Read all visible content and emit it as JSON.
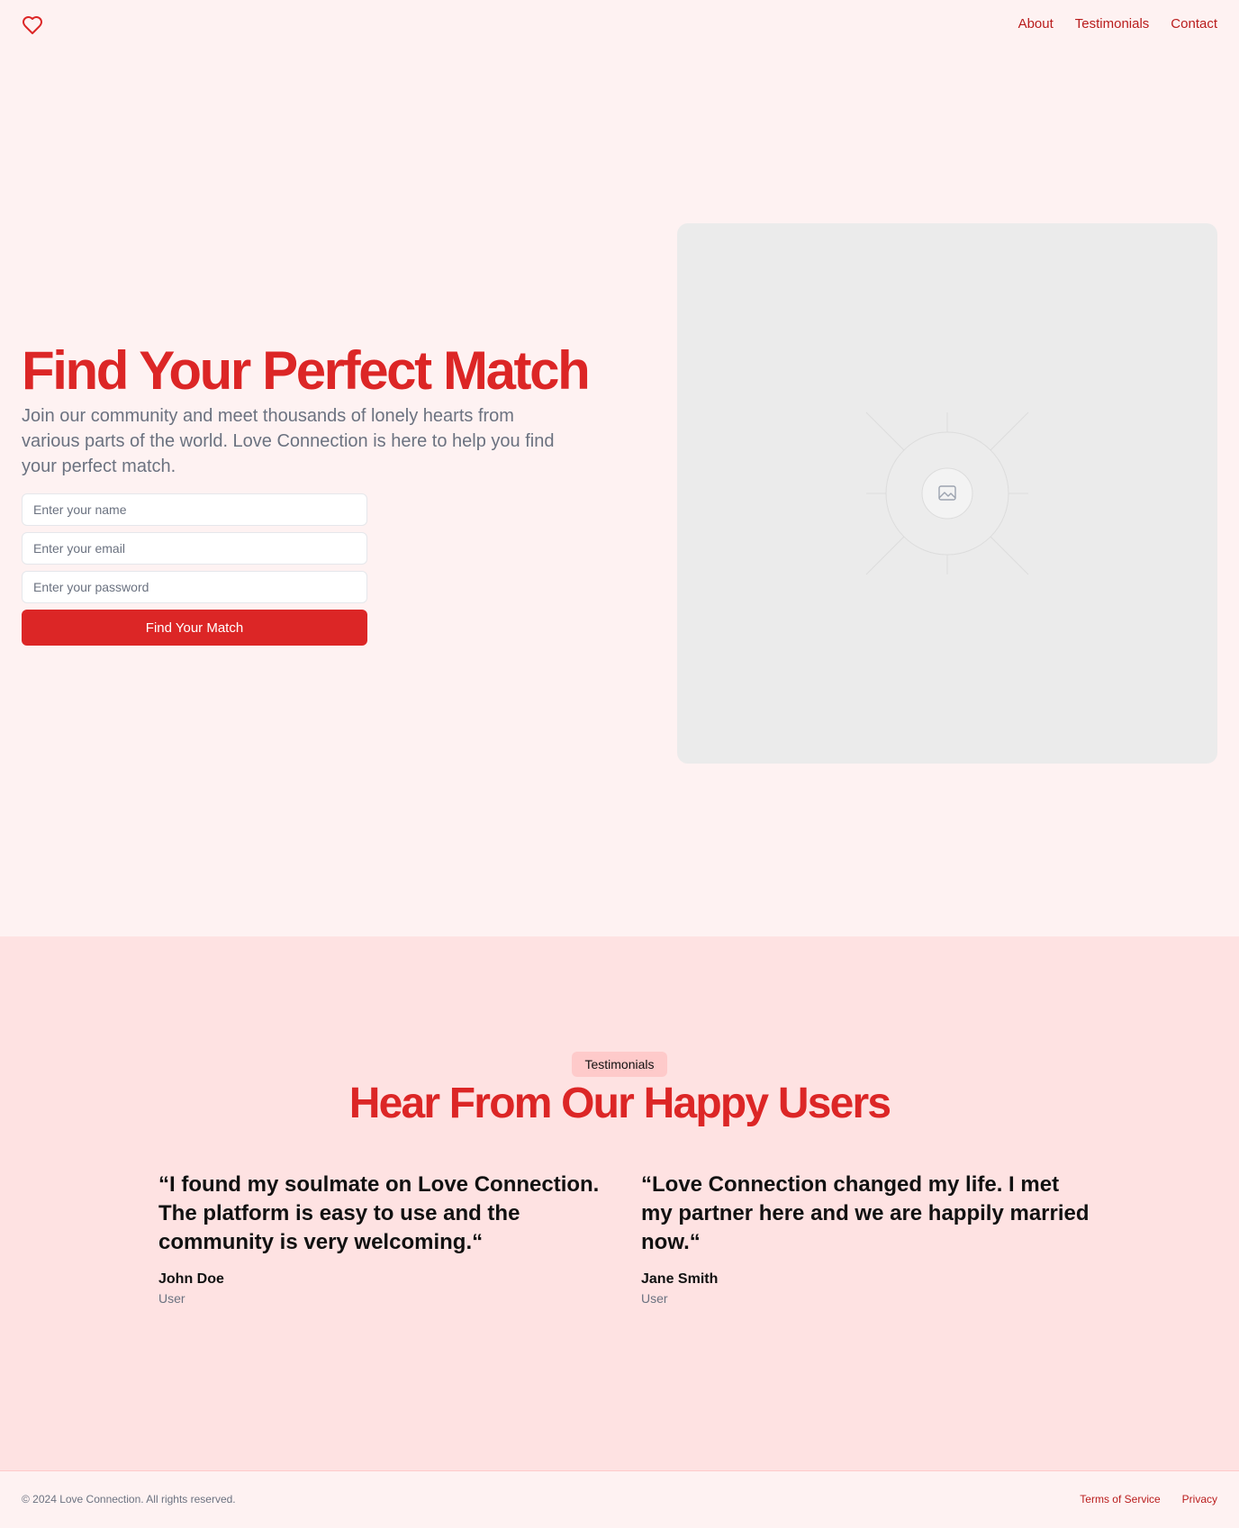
{
  "header": {
    "logo_icon": "heart-icon",
    "nav": [
      {
        "label": "About"
      },
      {
        "label": "Testimonials"
      },
      {
        "label": "Contact"
      }
    ]
  },
  "hero": {
    "title": "Find Your Perfect Match",
    "description": "Join our community and meet thousands of lonely hearts from various parts of the world. Love Connection is here to help you find your perfect match.",
    "form": {
      "name_placeholder": "Enter your name",
      "email_placeholder": "Enter your email",
      "password_placeholder": "Enter your password",
      "submit_label": "Find Your Match"
    },
    "image_icon": "image-placeholder-icon"
  },
  "testimonials": {
    "badge": "Testimonials",
    "title": "Hear From Our Happy Users",
    "items": [
      {
        "quote": "“I found my soulmate on Love Connection. The platform is easy to use and the community is very welcoming.“",
        "name": "John Doe",
        "role": "User"
      },
      {
        "quote": "“Love Connection changed my life. I met my partner here and we are happily married now.“",
        "name": "Jane Smith",
        "role": "User"
      }
    ]
  },
  "footer": {
    "copyright": "© 2024 Love Connection. All rights reserved.",
    "links": [
      {
        "label": "Terms of Service"
      },
      {
        "label": "Privacy"
      }
    ]
  },
  "colors": {
    "brand": "#dc2626",
    "background": "#fef2f2",
    "section": "#fee2e2"
  }
}
